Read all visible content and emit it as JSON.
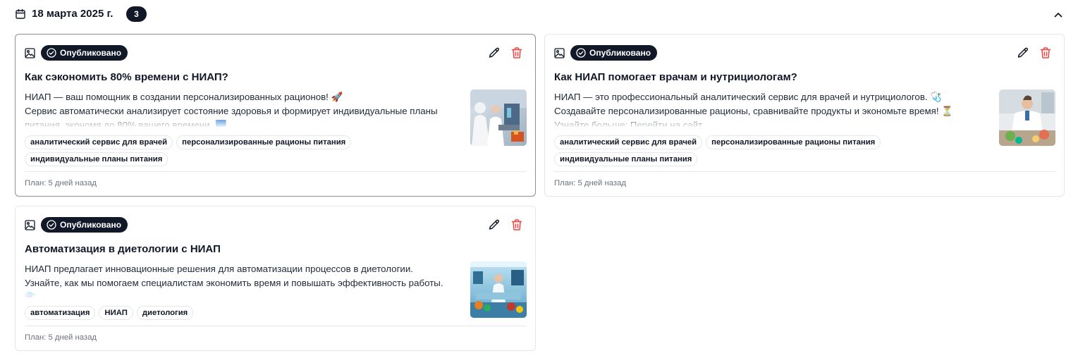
{
  "group": {
    "date": "18 марта 2025 г.",
    "count": "3",
    "icon": "calendar-icon",
    "collapse_icon": "chevron-up-icon"
  },
  "colors": {
    "badge_bg": "#111827",
    "delete_red": "#ef4444",
    "border": "#e5e7eb",
    "active_border": "#8b8f96"
  },
  "posts": [
    {
      "status": "Опубликовано",
      "title": "Как сэкономить 80% времени с НИАП?",
      "lines": [
        "НИАП — ваш помощник в создании персонализированных рационов! 🚀",
        "Сервис автоматически анализирует состояние здоровья и формирует индивидуальные планы",
        "питания, экономя до 80% вашего времени. 🟦"
      ],
      "tags": [
        "аналитический сервис для врачей",
        "персонализированные рационы питания",
        "индивидуальные планы питания"
      ],
      "plan": "План: 5 дней назад"
    },
    {
      "status": "Опубликовано",
      "title": "Как НИАП помогает врачам и нутрициологам?",
      "lines": [
        "НИАП — это профессиональный аналитический сервис для врачей и нутрициологов. 🩺",
        "Создавайте персонализированные рационы, сравнивайте продукты и экономьте время! ⏳",
        "Узнайте больше: Перейти на сайт"
      ],
      "tags": [
        "аналитический сервис для врачей",
        "персонализированные рационы питания",
        "индивидуальные планы питания"
      ],
      "plan": "План: 5 дней назад"
    },
    {
      "status": "Опубликовано",
      "title": "Автоматизация в диетологии с НИАП",
      "lines": [
        "НИАП предлагает инновационные решения для автоматизации процессов в диетологии.",
        "Узнайте, как мы помогаем специалистам экономить время и повышать эффективность работы.",
        "⚗️"
      ],
      "tags": [
        "автоматизация",
        "НИАП",
        "диетология"
      ],
      "plan": "План: 5 дней назад"
    }
  ]
}
